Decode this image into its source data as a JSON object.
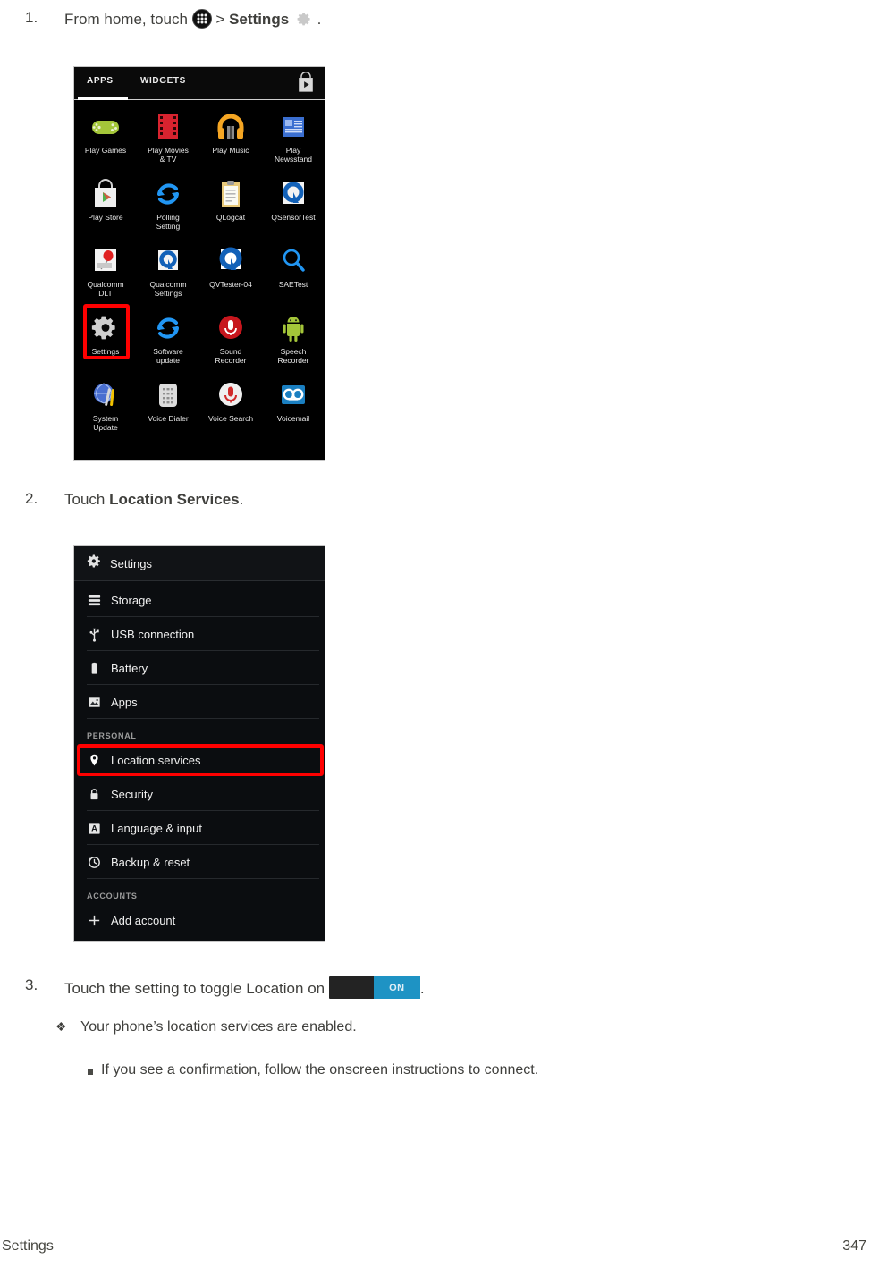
{
  "document": {
    "footer_left": "Settings",
    "footer_page": "347"
  },
  "steps": [
    {
      "number": "1.",
      "pre": "From home, touch",
      "mid": ">",
      "bold": "Settings",
      "post": "."
    },
    {
      "number": "2.",
      "pre": "Touch",
      "bold": "Location Services",
      "post": "."
    },
    {
      "number": "3.",
      "pre": "Touch the setting to toggle Location on",
      "post": "."
    }
  ],
  "toggle": {
    "state_label": "ON",
    "track_color": "#232323",
    "thumb_color": "#1e93c4"
  },
  "notes": {
    "diamond_bullet": "❖",
    "diamond_text": "Your phone’s location services are enabled.",
    "square_text": "If you see a confirmation, follow the onscreen instructions to connect."
  },
  "apps_drawer": {
    "tabs": [
      {
        "label": "APPS",
        "selected": true
      },
      {
        "label": "WIDGETS",
        "selected": false
      }
    ],
    "store_icon": "play-store-bag-icon",
    "highlight_color": "#ff0000",
    "highlighted_app": "Settings",
    "rows": [
      [
        {
          "label": "Play Games",
          "icon": "gamepad-icon"
        },
        {
          "label": "Play Movies\n& TV",
          "icon": "film-strip-icon"
        },
        {
          "label": "Play Music",
          "icon": "headphones-icon"
        },
        {
          "label": "Play\nNewsstand",
          "icon": "newspaper-icon"
        }
      ],
      [
        {
          "label": "Play Store",
          "icon": "shopping-bag-icon"
        },
        {
          "label": "Polling\nSetting",
          "icon": "refresh-arrows-icon"
        },
        {
          "label": "QLogcat",
          "icon": "clipboard-icon"
        },
        {
          "label": "QSensorTest",
          "icon": "qualcomm-q-icon"
        }
      ],
      [
        {
          "label": "Qualcomm\nDLT",
          "icon": "balloon-icon"
        },
        {
          "label": "Qualcomm\nSettings",
          "icon": "qualcomm-q-icon"
        },
        {
          "label": "QVTester-04",
          "icon": "qualcomm-q-icon"
        },
        {
          "label": "SAETest",
          "icon": "magnifier-icon"
        }
      ],
      [
        {
          "label": "Settings",
          "icon": "gear-icon"
        },
        {
          "label": "Software\nupdate",
          "icon": "refresh-arrows-icon"
        },
        {
          "label": "Sound\nRecorder",
          "icon": "microphone-red-icon"
        },
        {
          "label": "Speech\nRecorder",
          "icon": "android-robot-icon"
        }
      ],
      [
        {
          "label": "System\nUpdate",
          "icon": "globe-tools-icon"
        },
        {
          "label": "Voice Dialer",
          "icon": "keypad-icon"
        },
        {
          "label": "Voice Search",
          "icon": "microphone-icon"
        },
        {
          "label": "Voicemail",
          "icon": "voicemail-tape-icon"
        }
      ]
    ]
  },
  "settings_screen": {
    "header_title": "Settings",
    "header_icon": "gear-icon",
    "highlight_color": "#ff0000",
    "highlighted_item": "Location services",
    "items": [
      {
        "type": "item",
        "label": "Storage",
        "icon": "storage-stack-icon"
      },
      {
        "type": "item",
        "label": "USB connection",
        "icon": "usb-icon"
      },
      {
        "type": "item",
        "label": "Battery",
        "icon": "battery-icon"
      },
      {
        "type": "item",
        "label": "Apps",
        "icon": "apps-image-icon"
      },
      {
        "type": "section",
        "label": "PERSONAL"
      },
      {
        "type": "item",
        "label": "Location services",
        "icon": "map-pin-icon",
        "highlighted": true
      },
      {
        "type": "item",
        "label": "Security",
        "icon": "lock-icon"
      },
      {
        "type": "item",
        "label": "Language & input",
        "icon": "letter-a-icon"
      },
      {
        "type": "item",
        "label": "Backup & reset",
        "icon": "history-clock-icon"
      },
      {
        "type": "section",
        "label": "ACCOUNTS"
      },
      {
        "type": "item",
        "label": "Add account",
        "icon": "plus-icon"
      }
    ]
  }
}
